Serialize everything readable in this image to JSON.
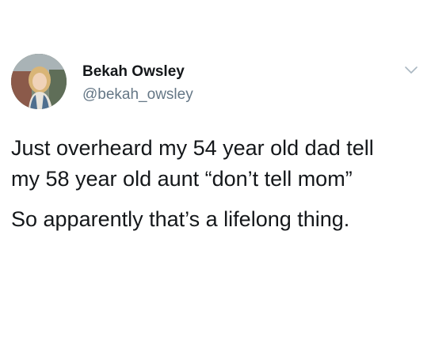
{
  "author": {
    "display_name": "Bekah Owsley",
    "handle": "@bekah_owsley",
    "avatar_icon": "profile-photo"
  },
  "menu": {
    "icon": "chevron-down-icon",
    "color": "#aab8c2"
  },
  "tweet": {
    "lines": [
      "Just overheard my 54 year old dad tell",
      "my 58 year old aunt “don’t tell mom”"
    ],
    "second_paragraph": "So apparently that’s a lifelong thing."
  },
  "colors": {
    "text": "#14171a",
    "secondary_text": "#657786",
    "background": "#ffffff"
  }
}
